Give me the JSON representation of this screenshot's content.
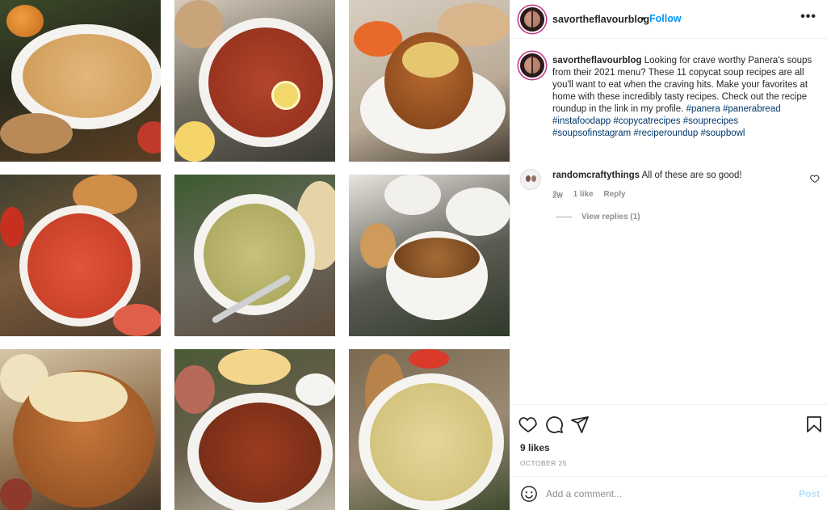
{
  "grid": {
    "tiles": [
      {
        "name": "pumpkin-soup-photo"
      },
      {
        "name": "vegetable-soup-photo"
      },
      {
        "name": "bread-bowl-soup-photo"
      },
      {
        "name": "tomato-soup-photo"
      },
      {
        "name": "chicken-noodle-soup-photo"
      },
      {
        "name": "french-onion-soup-photo"
      },
      {
        "name": "loaded-potato-bread-bowl-photo"
      },
      {
        "name": "turkey-chili-photo"
      },
      {
        "name": "corn-chowder-photo"
      }
    ]
  },
  "header": {
    "username": "savortheflavourblog",
    "separator": "•",
    "follow_label": "Follow",
    "more_icon": "ellipsis-icon"
  },
  "caption": {
    "username": "savortheflavourblog",
    "text": "Looking for crave worthy Panera's soups from their 2021 menu? These 11 copycat soup recipes are all you'll want to eat when the craving hits. Make your favorites at home with these incredibly tasty recipes. Check out the recipe roundup in the link in my profile.",
    "hashtags": [
      "#panera",
      "#panerabread",
      "#instafoodapp",
      "#copycatrecipes",
      "#souprecipes",
      "#soupsofinstagram",
      "#reciperoundup",
      "#soupbowl"
    ],
    "time": "2w"
  },
  "comment": {
    "username": "randomcraftythings",
    "text": "All of these are so good!",
    "time": "2w",
    "likes": "1 like",
    "reply_label": "Reply",
    "view_replies": "View replies (1)"
  },
  "actions": {
    "icons": [
      "heart-icon",
      "comment-icon",
      "share-icon",
      "bookmark-icon"
    ],
    "likes": "9 likes",
    "date": "OCTOBER 25"
  },
  "add_comment": {
    "placeholder": "Add a comment...",
    "post_label": "Post"
  }
}
